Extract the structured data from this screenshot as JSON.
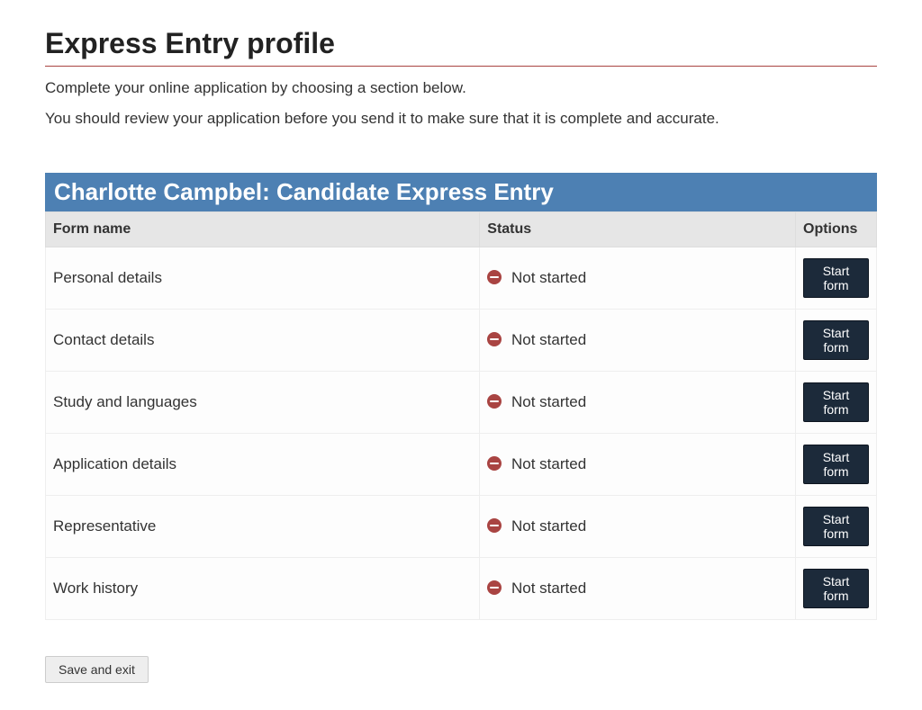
{
  "page_title": "Express Entry profile",
  "intro_1": "Complete your online application by choosing a section below.",
  "intro_2": "You should review your application before you send it to make sure that it is complete and accurate.",
  "section_header": "Charlotte Campbel: Candidate Express Entry",
  "columns": {
    "form_name": "Form name",
    "status": "Status",
    "options": "Options"
  },
  "forms": [
    {
      "name": "Personal details",
      "status": "Not started",
      "action": "Start form"
    },
    {
      "name": "Contact details",
      "status": "Not started",
      "action": "Start form"
    },
    {
      "name": "Study and languages",
      "status": "Not started",
      "action": "Start form"
    },
    {
      "name": "Application details",
      "status": "Not started",
      "action": "Start form"
    },
    {
      "name": "Representative",
      "status": "Not started",
      "action": "Start form"
    },
    {
      "name": "Work history",
      "status": "Not started",
      "action": "Start form"
    }
  ],
  "save_exit_label": "Save and exit"
}
